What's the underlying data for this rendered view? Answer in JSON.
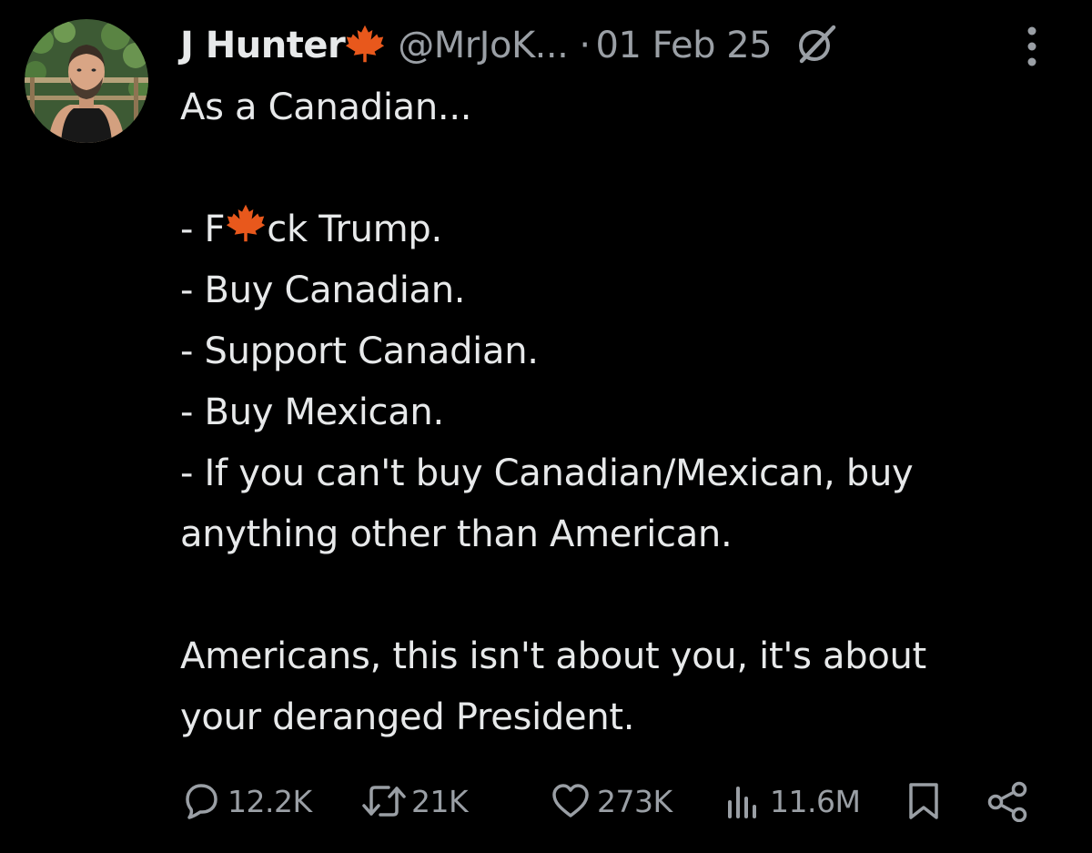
{
  "author": {
    "name": "J Hunter",
    "handle": "@MrJoK...",
    "separator": "·",
    "date": "01 Feb 25"
  },
  "tweet": {
    "line1": "As a Canadian...",
    "line2_a": "- F",
    "line2_b": "ck Trump.",
    "line3": "- Buy Canadian.",
    "line4": "- Support Canadian.",
    "line5": "- Buy Mexican.",
    "line6": "- If you can't buy Canadian/Mexican, buy",
    "line7": "anything other than American.",
    "line8": "Americans, this isn't about you, it's about",
    "line9": "your deranged President."
  },
  "stats": {
    "replies": "12.2K",
    "reposts": "21K",
    "likes": "273K",
    "views": "11.6M"
  },
  "colors": {
    "background": "#000000",
    "text": "#e7e9ea",
    "muted": "#9a9fa5",
    "maple": "#e8581c"
  },
  "icons": [
    "maple-leaf-icon",
    "grok-icon",
    "more-icon",
    "reply-icon",
    "repost-icon",
    "like-icon",
    "views-icon",
    "bookmark-icon",
    "share-icon"
  ]
}
